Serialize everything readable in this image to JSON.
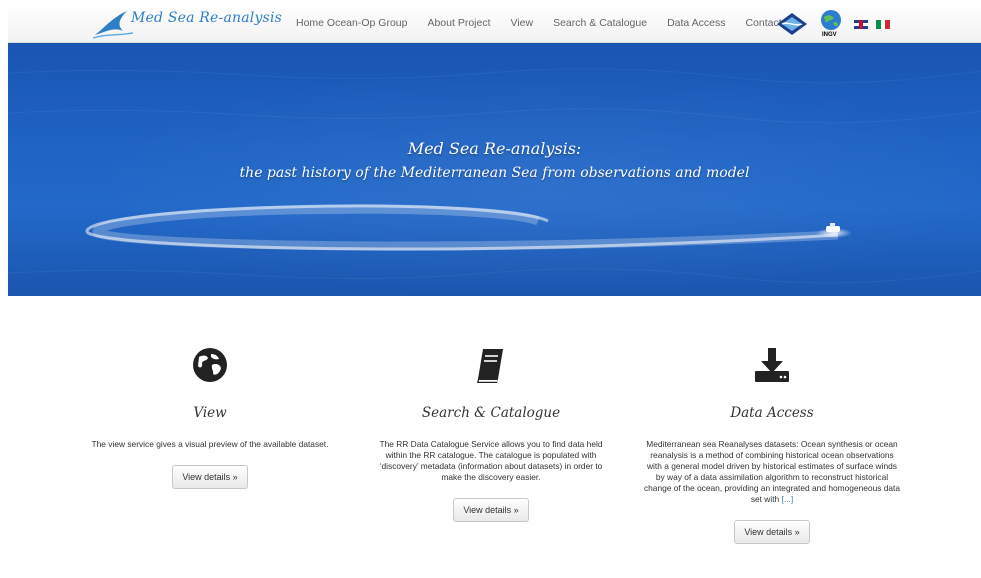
{
  "brand": {
    "name": "Med Sea Re-analysis"
  },
  "nav": {
    "items": [
      {
        "label": "Home Ocean-Op Group"
      },
      {
        "label": "About Project"
      },
      {
        "label": "View"
      },
      {
        "label": "Search & Catalogue"
      },
      {
        "label": "Data Access"
      },
      {
        "label": "Contacts"
      }
    ],
    "logos": {
      "ingv_label": "INGV"
    }
  },
  "hero": {
    "title": "Med Sea Re-analysis:",
    "subtitle": "the past history of the Mediterranean Sea from observations and model"
  },
  "features": [
    {
      "icon": "globe-icon",
      "title": "View",
      "text": "The view service gives a visual preview of the available dataset.",
      "button": "View details »"
    },
    {
      "icon": "book-icon",
      "title": "Search & Catalogue",
      "text": "The RR Data Catalogue Service allows you to find data held within the RR catalogue. The catalogue is populated with ‘discovery’ metadata (information about datasets) in order to make the discovery easier.",
      "button": "View details »"
    },
    {
      "icon": "download-icon",
      "title": "Data Access",
      "text": "Mediterranean sea Reanalyses datasets: Ocean synthesis or ocean reanalysis is a method of combining historical ocean observations with a general model driven by historical estimates of surface winds by way of a data assimilation algorithm to reconstruct historical change of the ocean, providing an integrated and homogeneous data set with",
      "more": "[...]",
      "button": "View details »"
    }
  ],
  "colors": {
    "accent": "#2f7fc6",
    "sea": "#1f63c4",
    "nav_text": "#666666"
  }
}
